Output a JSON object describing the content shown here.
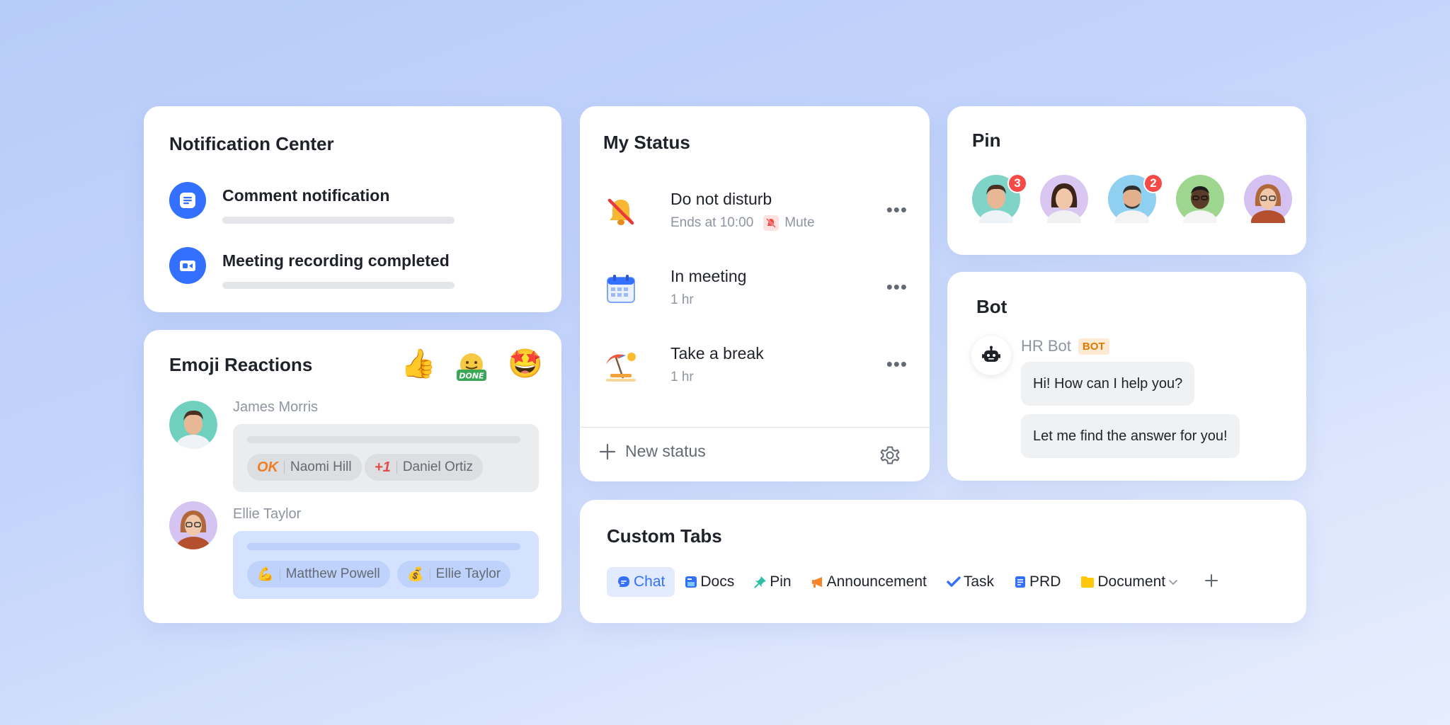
{
  "notification_center": {
    "title": "Notification Center",
    "items": [
      {
        "label": "Comment notification",
        "icon": "document-lines-icon"
      },
      {
        "label": "Meeting recording completed",
        "icon": "video-camera-icon"
      }
    ]
  },
  "emoji_reactions": {
    "title": "Emoji Reactions",
    "top_emojis": [
      "👍",
      "DONE",
      "🤩"
    ],
    "messages": [
      {
        "author": "James Morris",
        "reactions": [
          {
            "emoji": "OK",
            "user": "Naomi Hill"
          },
          {
            "emoji": "+1",
            "user": "Daniel Ortiz"
          }
        ]
      },
      {
        "author": "Ellie Taylor",
        "reactions": [
          {
            "emoji": "💪",
            "user": "Matthew Powell"
          },
          {
            "emoji": "💰",
            "user": "Ellie Taylor"
          }
        ]
      }
    ]
  },
  "my_status": {
    "title": "My Status",
    "items": [
      {
        "label": "Do not disturb",
        "sub": "Ends at 10:00",
        "extra": "Mute",
        "icon": "bell-muted-icon"
      },
      {
        "label": "In meeting",
        "sub": "1 hr",
        "icon": "calendar-icon"
      },
      {
        "label": "Take a break",
        "sub": "1 hr",
        "icon": "beach-umbrella-icon"
      }
    ],
    "new_status_label": "New status"
  },
  "pin": {
    "title": "Pin",
    "avatars": [
      {
        "badge": "3",
        "bg": "#7fd4c7"
      },
      {
        "badge": "",
        "bg": "#d9c7f2"
      },
      {
        "badge": "2",
        "bg": "#8fd0f0"
      },
      {
        "badge": "",
        "bg": "#9fd68f"
      },
      {
        "badge": "",
        "bg": "#d4c1f2"
      }
    ]
  },
  "bot": {
    "title": "Bot",
    "name": "HR Bot",
    "tag": "BOT",
    "messages": [
      "Hi! How can I help you?",
      "Let me find the answer for you!"
    ]
  },
  "custom_tabs": {
    "title": "Custom Tabs",
    "tabs": [
      {
        "label": "Chat",
        "icon": "chat-bubble-icon",
        "color": "#3370ff",
        "active": true
      },
      {
        "label": "Docs",
        "icon": "docs-icon",
        "color": "#3370ff"
      },
      {
        "label": "Pin",
        "icon": "pin-icon",
        "color": "#2dbea5"
      },
      {
        "label": "Announcement",
        "icon": "megaphone-icon",
        "color": "#f5842a"
      },
      {
        "label": "Task",
        "icon": "check-icon",
        "color": "#3370ff"
      },
      {
        "label": "PRD",
        "icon": "document-icon",
        "color": "#3370ff"
      },
      {
        "label": "Document",
        "icon": "folder-icon",
        "color": "#ffc60a"
      }
    ]
  },
  "colors": {
    "accent": "#3370ff",
    "badge_red": "#f54a45",
    "bot_tag": "#de7802"
  }
}
